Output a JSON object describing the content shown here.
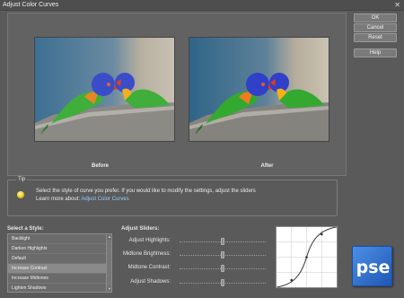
{
  "window": {
    "title": "Adjust Color Curves",
    "close_glyph": "✕"
  },
  "buttons": {
    "ok": "OK",
    "cancel": "Cancel",
    "reset": "Reset",
    "help": "Help"
  },
  "preview": {
    "before_label": "Before",
    "after_label": "After"
  },
  "tip": {
    "heading": "Tip",
    "line1": "Select the style of curve you prefer. If you would like to modify the settings, adjust the sliders",
    "learn_more_prefix": "Learn more about:",
    "learn_more_link": "Adjust Color Curves"
  },
  "styles": {
    "label": "Select a Style:",
    "items": [
      "Backlight",
      "Darken Highlights",
      "Default",
      "Increase Contrast",
      "Increase Midtones",
      "Lighten Shadows"
    ],
    "selected": "Increase Contrast"
  },
  "sliders": {
    "label": "Adjust Sliders:",
    "items": [
      {
        "label": "Adjust Highlights:",
        "value": 0.5
      },
      {
        "label": "Midtone Brightness:",
        "value": 0.5
      },
      {
        "label": "Midtone Contrast:",
        "value": 0.5
      },
      {
        "label": "Adjust Shadows:",
        "value": 0.5
      }
    ]
  },
  "logo": {
    "text": "pse"
  },
  "colors": {
    "link": "#9cc6ff",
    "panel": "#626262",
    "background": "#5a5a5a"
  }
}
